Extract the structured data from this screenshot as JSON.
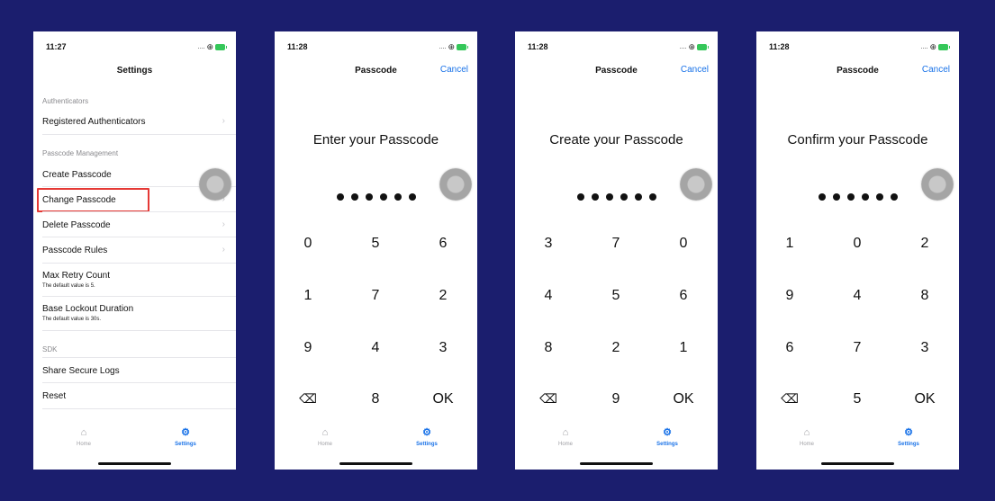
{
  "status": {
    "icons": "…. ⊕"
  },
  "screens": [
    {
      "time": "11:27",
      "title": "Settings",
      "sections": [
        {
          "header": "Authenticators"
        },
        {
          "header": "Passcode Management"
        },
        {
          "header": "SDK"
        }
      ],
      "rows": [
        {
          "label": "Registered Authenticators",
          "chevron": "›"
        },
        {
          "label": "Create Passcode",
          "chevron": "›"
        },
        {
          "label": "Change Passcode",
          "chevron": "›"
        },
        {
          "label": "Delete Passcode",
          "chevron": "›"
        },
        {
          "label": "Passcode Rules",
          "chevron": "›"
        },
        {
          "label": "Max Retry Count",
          "sub": "The default value is 5."
        },
        {
          "label": "Base Lockout Duration",
          "sub": "The default value is 30s."
        },
        {
          "label": "Share Secure Logs"
        },
        {
          "label": "Reset"
        }
      ]
    },
    {
      "time": "11:28",
      "title": "Passcode",
      "cancel": "Cancel",
      "prompt": "Enter your Passcode",
      "keys": [
        "0",
        "5",
        "6",
        "1",
        "7",
        "2",
        "9",
        "4",
        "3",
        "⌫",
        "8",
        "OK"
      ]
    },
    {
      "time": "11:28",
      "title": "Passcode",
      "cancel": "Cancel",
      "prompt": "Create your Passcode",
      "keys": [
        "3",
        "7",
        "0",
        "4",
        "5",
        "6",
        "8",
        "2",
        "1",
        "⌫",
        "9",
        "OK"
      ]
    },
    {
      "time": "11:28",
      "title": "Passcode",
      "cancel": "Cancel",
      "prompt": "Confirm your Passcode",
      "keys": [
        "1",
        "0",
        "2",
        "9",
        "4",
        "8",
        "6",
        "7",
        "3",
        "⌫",
        "5",
        "OK"
      ]
    }
  ],
  "tabs": {
    "home": "Home",
    "settings": "Settings",
    "home_icon": "house-icon",
    "settings_icon": "gear-icon"
  },
  "colors": {
    "background": "#1b1e6e",
    "accent": "#1a73e8",
    "highlight": "#e53935"
  }
}
